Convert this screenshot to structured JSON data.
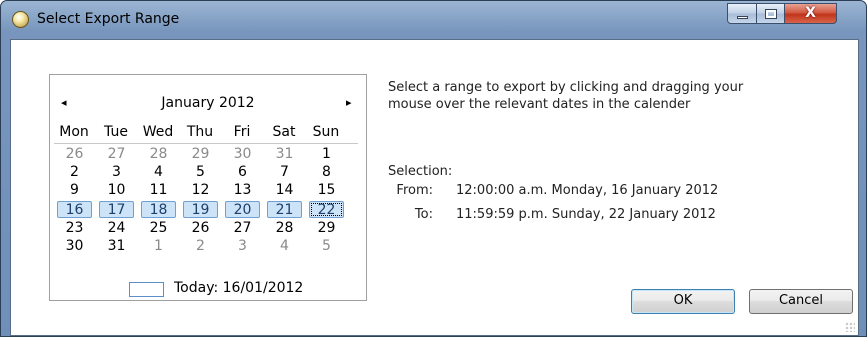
{
  "window": {
    "title": "Select Export Range",
    "close_glyph": "X"
  },
  "calendar": {
    "month_title": "January 2012",
    "prev_glyph": "◂",
    "next_glyph": "▸",
    "weekdays": [
      "Mon",
      "Tue",
      "Wed",
      "Thu",
      "Fri",
      "Sat",
      "Sun"
    ],
    "weeks": [
      [
        {
          "d": "26",
          "o": true
        },
        {
          "d": "27",
          "o": true
        },
        {
          "d": "28",
          "o": true
        },
        {
          "d": "29",
          "o": true
        },
        {
          "d": "30",
          "o": true
        },
        {
          "d": "31",
          "o": true
        },
        {
          "d": "1"
        }
      ],
      [
        {
          "d": "2"
        },
        {
          "d": "3"
        },
        {
          "d": "4"
        },
        {
          "d": "5"
        },
        {
          "d": "6"
        },
        {
          "d": "7"
        },
        {
          "d": "8"
        }
      ],
      [
        {
          "d": "9"
        },
        {
          "d": "10"
        },
        {
          "d": "11"
        },
        {
          "d": "12"
        },
        {
          "d": "13"
        },
        {
          "d": "14"
        },
        {
          "d": "15"
        }
      ],
      [
        {
          "d": "16",
          "s": true
        },
        {
          "d": "17",
          "s": true
        },
        {
          "d": "18",
          "s": true
        },
        {
          "d": "19",
          "s": true
        },
        {
          "d": "20",
          "s": true
        },
        {
          "d": "21",
          "s": true
        },
        {
          "d": "22",
          "s": true,
          "f": true
        }
      ],
      [
        {
          "d": "23"
        },
        {
          "d": "24"
        },
        {
          "d": "25"
        },
        {
          "d": "26"
        },
        {
          "d": "27"
        },
        {
          "d": "28"
        },
        {
          "d": "29"
        }
      ],
      [
        {
          "d": "30"
        },
        {
          "d": "31"
        },
        {
          "d": "1",
          "o": true
        },
        {
          "d": "2",
          "o": true
        },
        {
          "d": "3",
          "o": true
        },
        {
          "d": "4",
          "o": true
        },
        {
          "d": "5",
          "o": true
        }
      ]
    ],
    "today_label": "Today: 16/01/2012"
  },
  "info": {
    "instruction_line1": "Select a range to export by clicking and dragging your",
    "instruction_line2": "mouse over the relevant dates in the calender",
    "selection_label": "Selection:",
    "from_label": "From:",
    "from_value": "12:00:00 a.m. Monday, 16 January 2012",
    "to_label": "To:",
    "to_value": "11:59:59 p.m. Sunday, 22 January 2012"
  },
  "buttons": {
    "ok_label": "OK",
    "cancel_label": "Cancel"
  },
  "colors": {
    "selected_fill": "#cde3f7",
    "selected_border": "#6fa0d2",
    "close_red": "#c0341a"
  }
}
